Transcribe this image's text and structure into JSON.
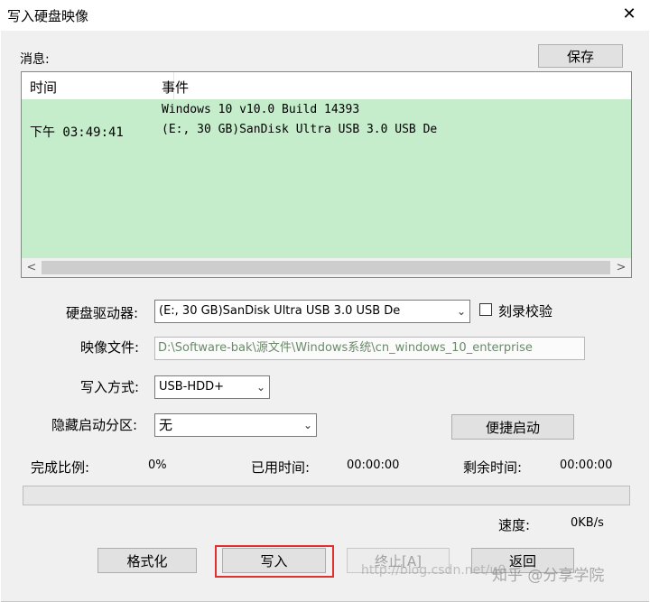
{
  "window": {
    "title": "写入硬盘映像",
    "close_glyph": "✕"
  },
  "messages": {
    "label": "消息:",
    "save_button": "保存",
    "columns": [
      "时间",
      "事件"
    ],
    "row": {
      "time": "下午 03:49:41",
      "events": [
        "Windows 10 v10.0 Build 14393",
        "(E:, 30 GB)SanDisk Ultra USB 3.0 USB De"
      ]
    },
    "scroll_left": "<",
    "scroll_right": ">"
  },
  "form": {
    "drive_label": "硬盘驱动器:",
    "drive_value": "(E:, 30 GB)SanDisk Ultra USB 3.0 USB De",
    "verify_label": "刻录校验",
    "verify_checked": false,
    "image_label": "映像文件:",
    "image_value": "D:\\Software-bak\\源文件\\Windows系统\\cn_windows_10_enterprise",
    "method_label": "写入方式:",
    "method_value": "USB-HDD+",
    "hidden_label": "隐藏启动分区:",
    "hidden_value": "无",
    "quickboot_button": "便捷启动"
  },
  "status": {
    "completion_label": "完成比例:",
    "completion_value": "0%",
    "elapsed_label": "已用时间:",
    "elapsed_value": "00:00:00",
    "remaining_label": "剩余时间:",
    "remaining_value": "00:00:00",
    "progress": 0,
    "speed_label": "速度:",
    "speed_value": "0KB/s"
  },
  "buttons": {
    "format": "格式化",
    "write": "写入",
    "stop": "终止[A]",
    "back": "返回"
  },
  "watermark": {
    "url": "http://blog.csdn.net/u0",
    "brand": "知乎 @分享学院"
  },
  "colors": {
    "log_row_bg": "#c5eccb",
    "highlight": "#e03030"
  }
}
